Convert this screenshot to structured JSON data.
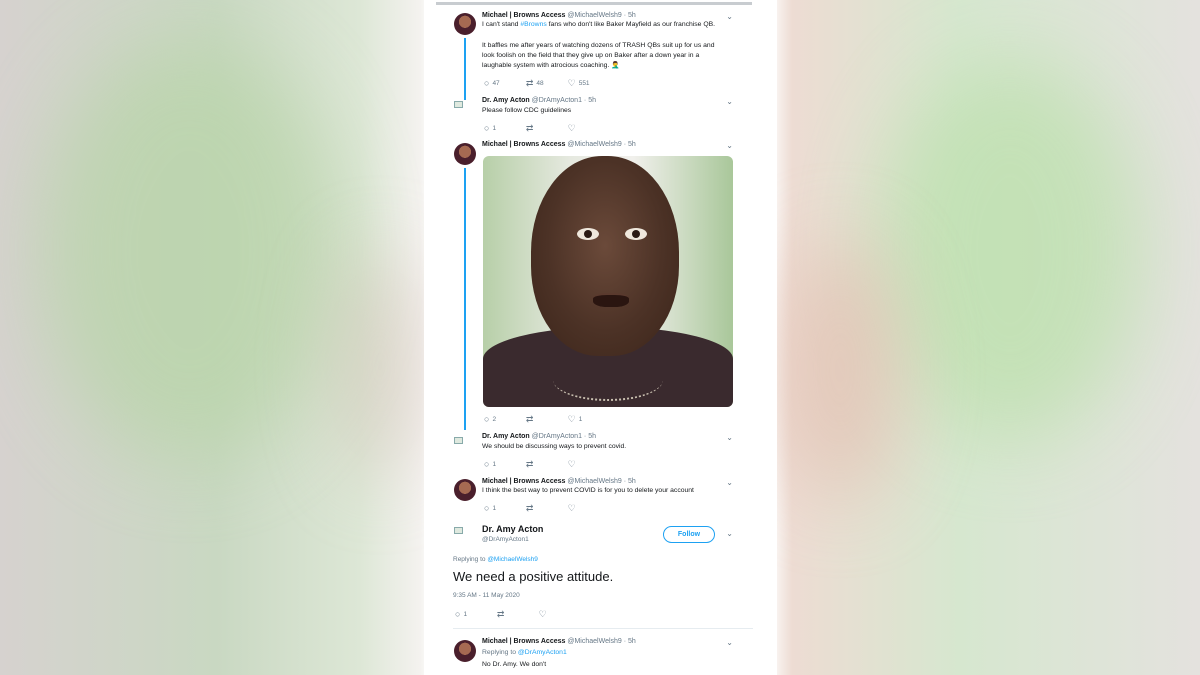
{
  "tweets": [
    {
      "name": "Michael | Browns Access",
      "handle": "@MichaelWelsh9",
      "time": "· 5h",
      "text_before_link": "I can't stand ",
      "link": "#Browns",
      "text_after_link": " fans who don't like Baker Mayfield as our franchise QB.",
      "text2": "It baffles me after years of watching dozens of TRASH QBs suit up for us and look foolish on the field that they give up on Baker after a down year in a laughable system with atrocious coaching. 🤦‍♂️",
      "replies": "47",
      "retweets": "48",
      "likes": "551"
    },
    {
      "name": "Dr. Amy Acton",
      "handle": "@DrAmyActon1",
      "time": "· 5h",
      "text": "Please follow CDC guidelines",
      "replies": "1",
      "retweets": "",
      "likes": ""
    },
    {
      "name": "Michael | Browns Access",
      "handle": "@MichaelWelsh9",
      "time": "· 5h",
      "replies": "2",
      "retweets": "",
      "likes": "1"
    },
    {
      "name": "Dr. Amy Acton",
      "handle": "@DrAmyActon1",
      "time": "· 5h",
      "text": "We should be discussing ways to prevent covid.",
      "replies": "1",
      "retweets": "",
      "likes": ""
    },
    {
      "name": "Michael | Browns Access",
      "handle": "@MichaelWelsh9",
      "time": "· 5h",
      "text": "I think the best way to prevent COVID is for you to delete your account",
      "replies": "1",
      "retweets": "",
      "likes": ""
    }
  ],
  "focused": {
    "name": "Dr. Amy Acton",
    "handle": "@DrAmyActon1",
    "follow_label": "Follow",
    "replying_prefix": "Replying to ",
    "replying_handle": "@MichaelWelsh9",
    "text": "We need a positive attitude.",
    "timestamp": "9:35 AM - 11 May 2020",
    "replies": "1"
  },
  "last_tweet": {
    "name": "Michael | Browns Access",
    "handle": "@MichaelWelsh9",
    "time": "· 5h",
    "replying_prefix": "Replying to ",
    "replying_handle": "@DrAmyActon1",
    "text": "No Dr. Amy. We don't"
  },
  "icons": {
    "reply": "reply-icon",
    "retweet": "retweet-icon",
    "like": "like-icon",
    "chevron": "chevron-down-icon"
  },
  "colors": {
    "accent": "#1da1f2",
    "text": "#14171a",
    "muted": "#657786"
  }
}
